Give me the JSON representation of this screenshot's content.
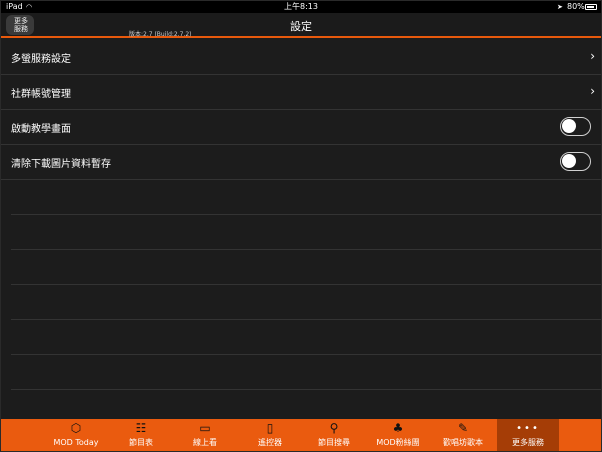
{
  "status_bar": {
    "device": "iPad",
    "time": "上午8:13",
    "battery": "80%"
  },
  "nav": {
    "back_label_line1": "更多",
    "back_label_line2": "服務",
    "version": "版本:2.7 (Build:2.7.2)",
    "title": "設定"
  },
  "settings": {
    "rows": [
      {
        "label": "多螢服務設定",
        "accessory": "chevron"
      },
      {
        "label": "社群帳號管理",
        "accessory": "chevron"
      },
      {
        "label": "啟動教學畫面",
        "accessory": "toggle",
        "on": false
      },
      {
        "label": "清除下載圖片資料暫存",
        "accessory": "toggle",
        "on": false
      }
    ]
  },
  "tabbar": {
    "tabs": [
      {
        "label": "MOD Today",
        "icon": "cube-icon"
      },
      {
        "label": "節目表",
        "icon": "list-icon"
      },
      {
        "label": "線上看",
        "icon": "tv-icon"
      },
      {
        "label": "遙控器",
        "icon": "remote-icon"
      },
      {
        "label": "節目搜尋",
        "icon": "search-icon"
      },
      {
        "label": "MOD粉絲團",
        "icon": "thumbs-up-icon"
      },
      {
        "label": "歡唱坊歌本",
        "icon": "pencil-icon"
      },
      {
        "label": "更多服務",
        "icon": "more-icon",
        "active": true
      }
    ]
  },
  "colors": {
    "accent": "#ea5b0f",
    "active_tab": "#a53d06",
    "background": "#1c1c1c"
  }
}
